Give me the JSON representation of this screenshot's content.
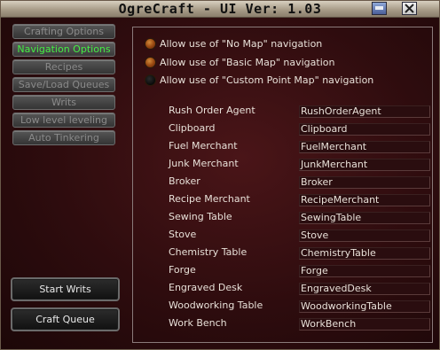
{
  "window": {
    "title": "OgreCraft - UI Ver: 1.03"
  },
  "sidebar": {
    "nav": [
      {
        "label": "Crafting Options",
        "active": false
      },
      {
        "label": "Navigation Options",
        "active": true
      },
      {
        "label": "Recipes",
        "active": false
      },
      {
        "label": "Save/Load Queues",
        "active": false
      },
      {
        "label": "Writs",
        "active": false
      },
      {
        "label": "Low level leveling",
        "active": false
      },
      {
        "label": "Auto Tinkering",
        "active": false
      }
    ],
    "start_writs": "Start Writs",
    "craft_queue": "Craft Queue"
  },
  "navigation": {
    "options": [
      {
        "label": "Allow use of \"No Map\" navigation",
        "selected": true
      },
      {
        "label": "Allow use of \"Basic Map\" navigation",
        "selected": true
      },
      {
        "label": "Allow use of \"Custom Point Map\" navigation",
        "selected": false
      }
    ],
    "merchants": [
      {
        "label": "Rush Order Agent",
        "value": "RushOrderAgent"
      },
      {
        "label": "Clipboard",
        "value": "Clipboard"
      },
      {
        "label": "Fuel Merchant",
        "value": "FuelMerchant"
      },
      {
        "label": "Junk Merchant",
        "value": "JunkMerchant"
      },
      {
        "label": "Broker",
        "value": "Broker"
      },
      {
        "label": "Recipe Merchant",
        "value": "RecipeMerchant"
      },
      {
        "label": "Sewing Table",
        "value": "SewingTable"
      },
      {
        "label": "Stove",
        "value": "Stove"
      },
      {
        "label": "Chemistry Table",
        "value": "ChemistryTable"
      },
      {
        "label": "Forge",
        "value": "Forge"
      },
      {
        "label": "Engraved Desk",
        "value": "EngravedDesk"
      },
      {
        "label": "Woodworking Table",
        "value": "WoodworkingTable"
      },
      {
        "label": "Work Bench",
        "value": "WorkBench"
      }
    ]
  }
}
